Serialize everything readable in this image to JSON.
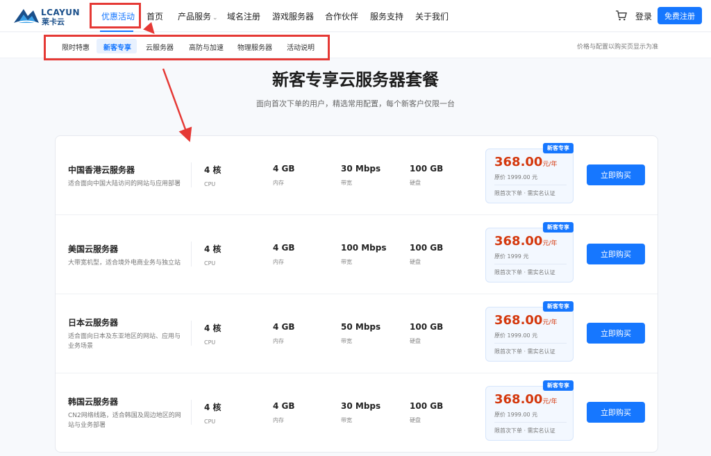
{
  "logo": {
    "text": "LCAYUN",
    "sub": "莱卡云"
  },
  "nav": {
    "items": [
      {
        "label": "优惠活动",
        "active": true
      },
      {
        "label": "首页"
      },
      {
        "label": "产品服务",
        "caret": "⌄"
      },
      {
        "label": "域名注册"
      },
      {
        "label": "游戏服务器"
      },
      {
        "label": "合作伙伴"
      },
      {
        "label": "服务支持"
      },
      {
        "label": "关于我们"
      }
    ],
    "login": "登录",
    "register": "免费注册",
    "cart_icon": "cart-icon"
  },
  "subnav": {
    "items": [
      {
        "label": "限时特惠"
      },
      {
        "label": "新客专享",
        "active": true
      },
      {
        "label": "云服务器"
      },
      {
        "label": "高防与加速"
      },
      {
        "label": "物理服务器"
      },
      {
        "label": "活动说明"
      }
    ],
    "note": "价格与配置以购买页显示为准"
  },
  "hero": {
    "title": "新客专享云服务器套餐",
    "subtitle": "面向首次下单的用户，精选常用配置，每个新客户仅限一台"
  },
  "rows": [
    {
      "name": "中国香港云服务器",
      "desc": "适合面向中国大陆访问的网站与应用部署",
      "cpu": "4 核",
      "cpu_lbl": "CPU",
      "mem": "4 GB",
      "mem_lbl": "内存",
      "bw": "30 Mbps",
      "bw_lbl": "带宽",
      "disk": "100 GB",
      "disk_lbl": "硬盘",
      "badge": "新客专享",
      "price": "368.00",
      "unit": "元/年",
      "orig": "原价 1999.00 元",
      "limit": "限首次下单 · 需实名认证",
      "buy": "立即购买"
    },
    {
      "name": "美国云服务器",
      "desc": "大带宽机型，适合境外电商业务与独立站",
      "cpu": "4 核",
      "cpu_lbl": "CPU",
      "mem": "4 GB",
      "mem_lbl": "内存",
      "bw": "100 Mbps",
      "bw_lbl": "带宽",
      "disk": "100 GB",
      "disk_lbl": "硬盘",
      "badge": "新客专享",
      "price": "368.00",
      "unit": "元/年",
      "orig": "原价 1999 元",
      "limit": "限首次下单 · 需实名认证",
      "buy": "立即购买"
    },
    {
      "name": "日本云服务器",
      "desc": "适合面向日本及东亚地区的网站、应用与业务场景",
      "cpu": "4 核",
      "cpu_lbl": "CPU",
      "mem": "4 GB",
      "mem_lbl": "内存",
      "bw": "50 Mbps",
      "bw_lbl": "带宽",
      "disk": "100 GB",
      "disk_lbl": "硬盘",
      "badge": "新客专享",
      "price": "368.00",
      "unit": "元/年",
      "orig": "原价 1999.00 元",
      "limit": "限首次下单 · 需实名认证",
      "buy": "立即购买"
    },
    {
      "name": "韩国云服务器",
      "desc": "CN2网络线路，适合韩国及周边地区的网站与业务部署",
      "cpu": "4 核",
      "cpu_lbl": "CPU",
      "mem": "4 GB",
      "mem_lbl": "内存",
      "bw": "30 Mbps",
      "bw_lbl": "带宽",
      "disk": "100 GB",
      "disk_lbl": "硬盘",
      "badge": "新客专享",
      "price": "368.00",
      "unit": "元/年",
      "orig": "原价 1999.00 元",
      "limit": "限首次下单 · 需实名认证",
      "buy": "立即购买"
    }
  ],
  "colors": {
    "accent": "#1677ff",
    "price": "#d4380d",
    "annotation": "#e53935"
  }
}
